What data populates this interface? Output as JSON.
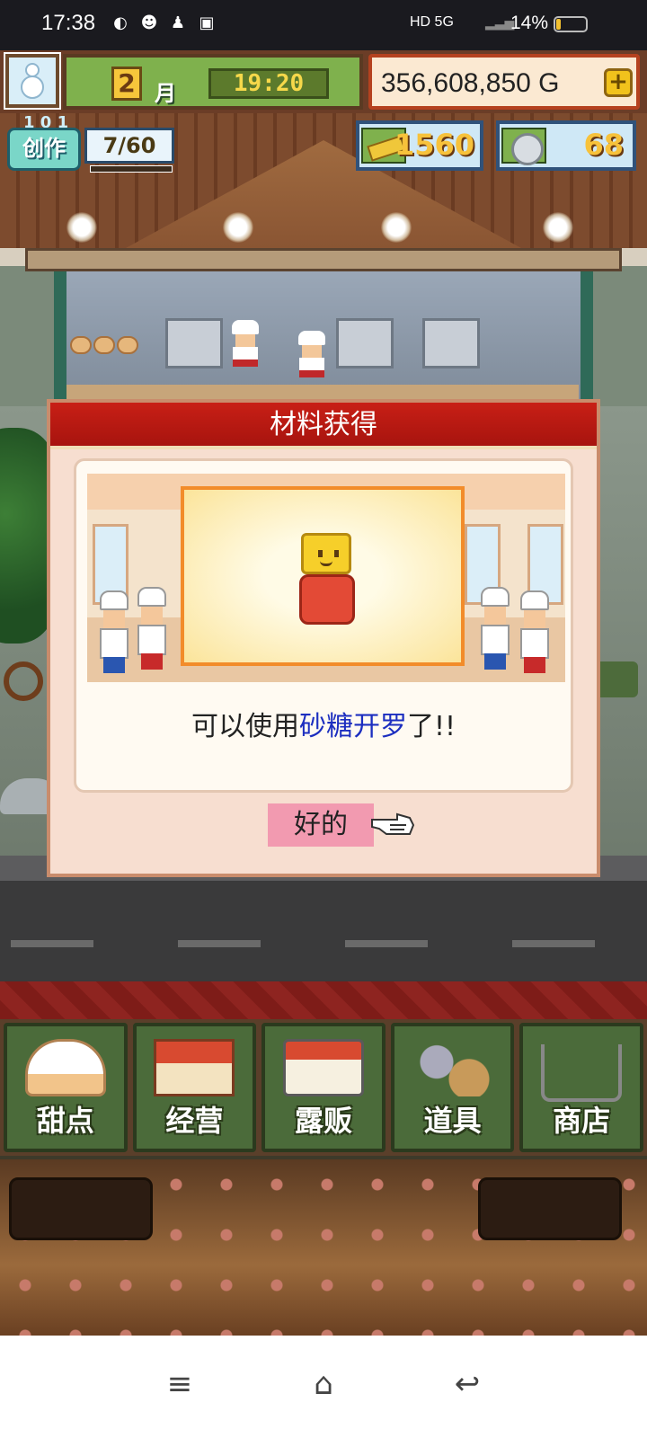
{
  "status_bar": {
    "time": "17:38",
    "network": "HD 5G",
    "battery_percent": "14%",
    "battery_level": 0.14
  },
  "hud": {
    "month_number": "2",
    "month_label": "月",
    "clock": "19:20",
    "money": "356,608,850 G",
    "money_add": "+",
    "create_badge": "创作",
    "create_top": "1 0 1",
    "create_count": "7/60",
    "tickets": "1560",
    "coins": "68"
  },
  "dialog": {
    "title": "材料获得",
    "message_prefix": "可以使用",
    "message_highlight": "砂糖开罗",
    "message_suffix": "了!!",
    "ok_button": "好的"
  },
  "menu": {
    "items": [
      {
        "label": "甜点",
        "icon": "cake-icon"
      },
      {
        "label": "经营",
        "icon": "shop-icon"
      },
      {
        "label": "露贩",
        "icon": "food-truck-icon"
      },
      {
        "label": "道具",
        "icon": "tools-icon"
      },
      {
        "label": "商店",
        "icon": "cart-icon"
      }
    ]
  },
  "navbar": {
    "menu_icon": "≡",
    "home_icon": "⌂",
    "back_icon": "↩"
  },
  "colors": {
    "dialog_title_bg": "#c81f16",
    "highlight_text": "#1c2ec0",
    "ok_button_bg": "#f29ab0",
    "menu_button_bg": "#4b6b3a"
  }
}
